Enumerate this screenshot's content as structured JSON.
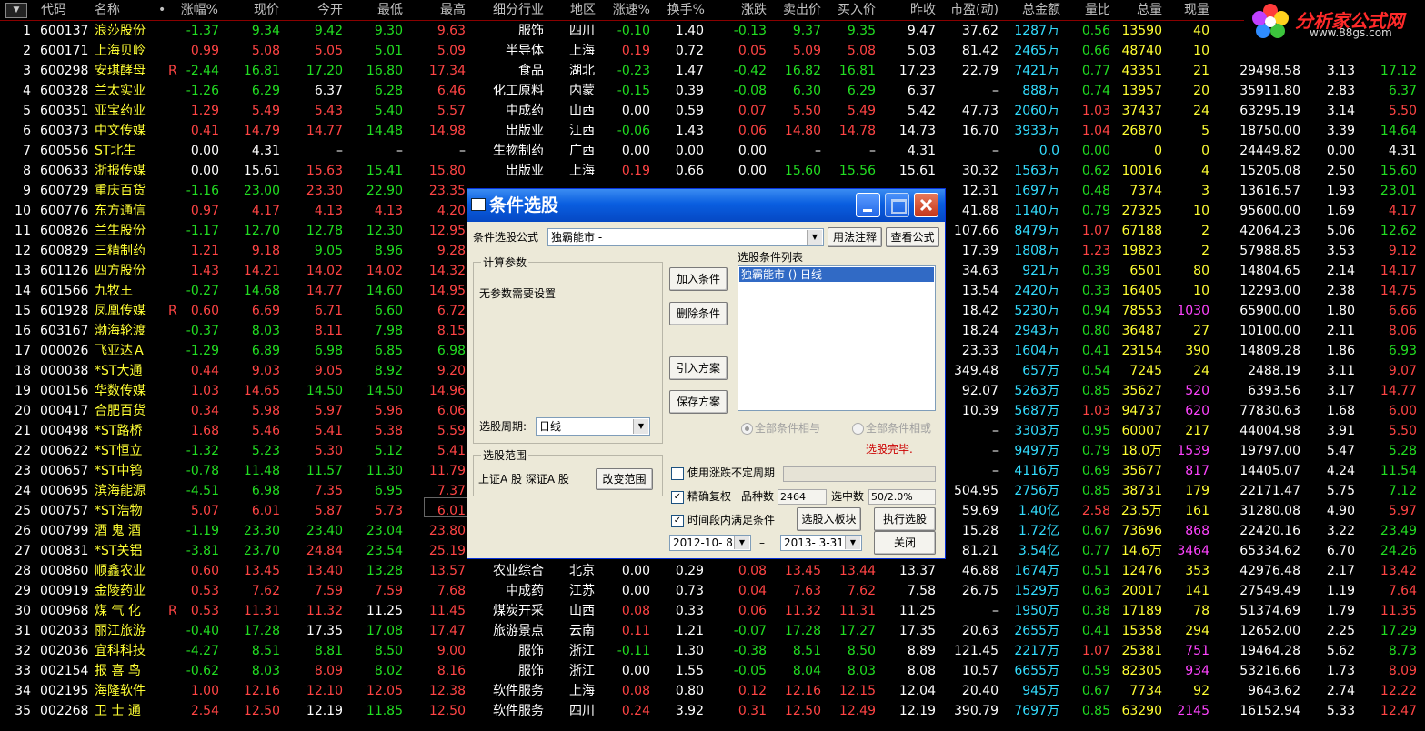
{
  "header": {
    "columns": [
      "代码",
      "名称",
      "•",
      "涨幅%",
      "现价",
      "今开",
      "最低",
      "最高",
      "细分行业",
      "地区",
      "涨速%",
      "换手%",
      "涨跌",
      "卖出价",
      "买入价",
      "昨收",
      "市盈(动)",
      "总金额",
      "量比",
      "总量",
      "现量"
    ],
    "sort_arrow_icon": "triangle-down-icon"
  },
  "logo": {
    "text": "分析家公式网",
    "url": "www.88gs.com"
  },
  "rows": [
    {
      "n": "1",
      "code": "600137",
      "name": "浪莎股份",
      "flag": "",
      "chg": "-1.37",
      "price": "9.34",
      "open": "9.42",
      "low": "9.30",
      "high": "9.63",
      "ind": "服饰",
      "region": "四川",
      "spd": "-0.10",
      "turn": "1.40",
      "diff": "-0.13",
      "ask": "9.37",
      "bid": "9.35",
      "prev": "9.47",
      "pe": "37.62",
      "amt": "1287万",
      "vr": "0.56",
      "vol": "13590",
      "cur": "40",
      "x1": "",
      "x2": "",
      "x3": ""
    },
    {
      "n": "2",
      "code": "600171",
      "name": "上海贝岭",
      "flag": "",
      "chg": "0.99",
      "price": "5.08",
      "open": "5.05",
      "low": "5.01",
      "high": "5.09",
      "ind": "半导体",
      "region": "上海",
      "spd": "0.19",
      "turn": "0.72",
      "diff": "0.05",
      "ask": "5.09",
      "bid": "5.08",
      "prev": "5.03",
      "pe": "81.42",
      "amt": "2465万",
      "vr": "0.66",
      "vol": "48740",
      "cur": "10",
      "x1": "",
      "x2": "",
      "x3": ""
    },
    {
      "n": "3",
      "code": "600298",
      "name": "安琪酵母",
      "flag": "R",
      "chg": "-2.44",
      "price": "16.81",
      "open": "17.20",
      "low": "16.80",
      "high": "17.34",
      "ind": "食品",
      "region": "湖北",
      "spd": "-0.23",
      "turn": "1.47",
      "diff": "-0.42",
      "ask": "16.82",
      "bid": "16.81",
      "prev": "17.23",
      "pe": "22.79",
      "amt": "7421万",
      "vr": "0.77",
      "vol": "43351",
      "cur": "21",
      "x1": "29498.58",
      "x2": "3.13",
      "x3": "17.12"
    },
    {
      "n": "4",
      "code": "600328",
      "name": "兰太实业",
      "flag": "",
      "chg": "-1.26",
      "price": "6.29",
      "open": "6.37",
      "low": "6.28",
      "high": "6.46",
      "ind": "化工原料",
      "region": "内蒙",
      "spd": "-0.15",
      "turn": "0.39",
      "diff": "-0.08",
      "ask": "6.30",
      "bid": "6.29",
      "prev": "6.37",
      "pe": "–",
      "amt": "888万",
      "vr": "0.74",
      "vol": "13957",
      "cur": "20",
      "x1": "35911.80",
      "x2": "2.83",
      "x3": "6.37"
    },
    {
      "n": "5",
      "code": "600351",
      "name": "亚宝药业",
      "flag": "",
      "chg": "1.29",
      "price": "5.49",
      "open": "5.43",
      "low": "5.40",
      "high": "5.57",
      "ind": "中成药",
      "region": "山西",
      "spd": "0.00",
      "turn": "0.59",
      "diff": "0.07",
      "ask": "5.50",
      "bid": "5.49",
      "prev": "5.42",
      "pe": "47.73",
      "amt": "2060万",
      "vr": "1.03",
      "vol": "37437",
      "cur": "24",
      "x1": "63295.19",
      "x2": "3.14",
      "x3": "5.50"
    },
    {
      "n": "6",
      "code": "600373",
      "name": "中文传媒",
      "flag": "",
      "chg": "0.41",
      "price": "14.79",
      "open": "14.77",
      "low": "14.48",
      "high": "14.98",
      "ind": "出版业",
      "region": "江西",
      "spd": "-0.06",
      "turn": "1.43",
      "diff": "0.06",
      "ask": "14.80",
      "bid": "14.78",
      "prev": "14.73",
      "pe": "16.70",
      "amt": "3933万",
      "vr": "1.04",
      "vol": "26870",
      "cur": "5",
      "x1": "18750.00",
      "x2": "3.39",
      "x3": "14.64"
    },
    {
      "n": "7",
      "code": "600556",
      "name": "ST北生",
      "flag": "",
      "chg": "0.00",
      "price": "4.31",
      "open": "–",
      "low": "–",
      "high": "–",
      "ind": "生物制药",
      "region": "广西",
      "spd": "0.00",
      "turn": "0.00",
      "diff": "0.00",
      "ask": "–",
      "bid": "–",
      "prev": "4.31",
      "pe": "–",
      "amt": "0.0",
      "vr": "0.00",
      "vol": "0",
      "cur": "0",
      "x1": "24449.82",
      "x2": "0.00",
      "x3": "4.31"
    },
    {
      "n": "8",
      "code": "600633",
      "name": "浙报传媒",
      "flag": "",
      "chg": "0.00",
      "price": "15.61",
      "open": "15.63",
      "low": "15.41",
      "high": "15.80",
      "ind": "出版业",
      "region": "上海",
      "spd": "0.19",
      "turn": "0.66",
      "diff": "0.00",
      "ask": "15.60",
      "bid": "15.56",
      "prev": "15.61",
      "pe": "30.32",
      "amt": "1563万",
      "vr": "0.62",
      "vol": "10016",
      "cur": "4",
      "x1": "15205.08",
      "x2": "2.50",
      "x3": "15.60"
    },
    {
      "n": "9",
      "code": "600729",
      "name": "重庆百货",
      "flag": "",
      "chg": "-1.16",
      "price": "23.00",
      "open": "23.30",
      "low": "22.90",
      "high": "23.35",
      "ind": "",
      "region": "",
      "spd": "",
      "turn": "",
      "diff": "",
      "ask": "",
      "bid": "",
      "prev": "",
      "pe": "12.31",
      "amt": "1697万",
      "vr": "0.48",
      "vol": "7374",
      "cur": "3",
      "x1": "13616.57",
      "x2": "1.93",
      "x3": "23.01"
    },
    {
      "n": "10",
      "code": "600776",
      "name": "东方通信",
      "flag": "",
      "chg": "0.97",
      "price": "4.17",
      "open": "4.13",
      "low": "4.13",
      "high": "4.20",
      "ind": "",
      "region": "",
      "spd": "",
      "turn": "",
      "diff": "",
      "ask": "",
      "bid": "",
      "prev": "",
      "pe": "41.88",
      "amt": "1140万",
      "vr": "0.79",
      "vol": "27325",
      "cur": "10",
      "x1": "95600.00",
      "x2": "1.69",
      "x3": "4.17"
    },
    {
      "n": "11",
      "code": "600826",
      "name": "兰生股份",
      "flag": "",
      "chg": "-1.17",
      "price": "12.70",
      "open": "12.78",
      "low": "12.30",
      "high": "12.95",
      "ind": "",
      "region": "",
      "spd": "",
      "turn": "",
      "diff": "",
      "ask": "",
      "bid": "",
      "prev": "",
      "pe": "107.66",
      "amt": "8479万",
      "vr": "1.07",
      "vol": "67188",
      "cur": "2",
      "x1": "42064.23",
      "x2": "5.06",
      "x3": "12.62"
    },
    {
      "n": "12",
      "code": "600829",
      "name": "三精制药",
      "flag": "",
      "chg": "1.21",
      "price": "9.18",
      "open": "9.05",
      "low": "8.96",
      "high": "9.28",
      "ind": "",
      "region": "",
      "spd": "",
      "turn": "",
      "diff": "",
      "ask": "",
      "bid": "",
      "prev": "",
      "pe": "17.39",
      "amt": "1808万",
      "vr": "1.23",
      "vol": "19823",
      "cur": "2",
      "x1": "57988.85",
      "x2": "3.53",
      "x3": "9.12"
    },
    {
      "n": "13",
      "code": "601126",
      "name": "四方股份",
      "flag": "",
      "chg": "1.43",
      "price": "14.21",
      "open": "14.02",
      "low": "14.02",
      "high": "14.32",
      "ind": "",
      "region": "",
      "spd": "",
      "turn": "",
      "diff": "",
      "ask": "",
      "bid": "",
      "prev": "",
      "pe": "34.63",
      "amt": "921万",
      "vr": "0.39",
      "vol": "6501",
      "cur": "80",
      "x1": "14804.65",
      "x2": "2.14",
      "x3": "14.17"
    },
    {
      "n": "14",
      "code": "601566",
      "name": "九牧王",
      "flag": "",
      "chg": "-0.27",
      "price": "14.68",
      "open": "14.77",
      "low": "14.60",
      "high": "14.95",
      "ind": "",
      "region": "",
      "spd": "",
      "turn": "",
      "diff": "",
      "ask": "",
      "bid": "",
      "prev": "",
      "pe": "13.54",
      "amt": "2420万",
      "vr": "0.33",
      "vol": "16405",
      "cur": "10",
      "x1": "12293.00",
      "x2": "2.38",
      "x3": "14.75"
    },
    {
      "n": "15",
      "code": "601928",
      "name": "凤凰传媒",
      "flag": "R",
      "chg": "0.60",
      "price": "6.69",
      "open": "6.71",
      "low": "6.60",
      "high": "6.72",
      "ind": "",
      "region": "",
      "spd": "",
      "turn": "",
      "diff": "",
      "ask": "",
      "bid": "",
      "prev": "",
      "pe": "18.42",
      "amt": "5230万",
      "vr": "0.94",
      "vol": "78553",
      "cur": "1030",
      "x1": "65900.00",
      "x2": "1.80",
      "x3": "6.66"
    },
    {
      "n": "16",
      "code": "603167",
      "name": "渤海轮渡",
      "flag": "",
      "chg": "-0.37",
      "price": "8.03",
      "open": "8.11",
      "low": "7.98",
      "high": "8.15",
      "ind": "",
      "region": "",
      "spd": "",
      "turn": "",
      "diff": "",
      "ask": "",
      "bid": "",
      "prev": "",
      "pe": "18.24",
      "amt": "2943万",
      "vr": "0.80",
      "vol": "36487",
      "cur": "27",
      "x1": "10100.00",
      "x2": "2.11",
      "x3": "8.06"
    },
    {
      "n": "17",
      "code": "000026",
      "name": "飞亚达Ａ",
      "flag": "",
      "chg": "-1.29",
      "price": "6.89",
      "open": "6.98",
      "low": "6.85",
      "high": "6.98",
      "ind": "",
      "region": "",
      "spd": "",
      "turn": "",
      "diff": "",
      "ask": "",
      "bid": "",
      "prev": "",
      "pe": "23.33",
      "amt": "1604万",
      "vr": "0.41",
      "vol": "23154",
      "cur": "390",
      "x1": "14809.28",
      "x2": "1.86",
      "x3": "6.93"
    },
    {
      "n": "18",
      "code": "000038",
      "name": "*ST大通",
      "flag": "",
      "chg": "0.44",
      "price": "9.03",
      "open": "9.05",
      "low": "8.92",
      "high": "9.20",
      "ind": "",
      "region": "",
      "spd": "",
      "turn": "",
      "diff": "",
      "ask": "",
      "bid": "",
      "prev": "",
      "pe": "349.48",
      "amt": "657万",
      "vr": "0.54",
      "vol": "7245",
      "cur": "24",
      "x1": "2488.19",
      "x2": "3.11",
      "x3": "9.07"
    },
    {
      "n": "19",
      "code": "000156",
      "name": "华数传媒",
      "flag": "",
      "chg": "1.03",
      "price": "14.65",
      "open": "14.50",
      "low": "14.50",
      "high": "14.96",
      "ind": "",
      "region": "",
      "spd": "",
      "turn": "",
      "diff": "",
      "ask": "",
      "bid": "",
      "prev": "",
      "pe": "92.07",
      "amt": "5263万",
      "vr": "0.85",
      "vol": "35627",
      "cur": "520",
      "x1": "6393.56",
      "x2": "3.17",
      "x3": "14.77"
    },
    {
      "n": "20",
      "code": "000417",
      "name": "合肥百货",
      "flag": "",
      "chg": "0.34",
      "price": "5.98",
      "open": "5.97",
      "low": "5.96",
      "high": "6.06",
      "ind": "",
      "region": "",
      "spd": "",
      "turn": "",
      "diff": "",
      "ask": "",
      "bid": "",
      "prev": "",
      "pe": "10.39",
      "amt": "5687万",
      "vr": "1.03",
      "vol": "94737",
      "cur": "620",
      "x1": "77830.63",
      "x2": "1.68",
      "x3": "6.00"
    },
    {
      "n": "21",
      "code": "000498",
      "name": "*ST路桥",
      "flag": "",
      "chg": "1.68",
      "price": "5.46",
      "open": "5.41",
      "low": "5.38",
      "high": "5.59",
      "ind": "",
      "region": "",
      "spd": "",
      "turn": "",
      "diff": "",
      "ask": "",
      "bid": "",
      "prev": "",
      "pe": "–",
      "amt": "3303万",
      "vr": "0.95",
      "vol": "60007",
      "cur": "217",
      "x1": "44004.98",
      "x2": "3.91",
      "x3": "5.50"
    },
    {
      "n": "22",
      "code": "000622",
      "name": "*ST恒立",
      "flag": "",
      "chg": "-1.32",
      "price": "5.23",
      "open": "5.30",
      "low": "5.12",
      "high": "5.41",
      "ind": "",
      "region": "",
      "spd": "",
      "turn": "",
      "diff": "",
      "ask": "",
      "bid": "",
      "prev": "",
      "pe": "–",
      "amt": "9497万",
      "vr": "0.79",
      "vol": "18.0万",
      "cur": "1539",
      "x1": "19797.00",
      "x2": "5.47",
      "x3": "5.28"
    },
    {
      "n": "23",
      "code": "000657",
      "name": "*ST中钨",
      "flag": "",
      "chg": "-0.78",
      "price": "11.48",
      "open": "11.57",
      "low": "11.30",
      "high": "11.79",
      "ind": "",
      "region": "",
      "spd": "",
      "turn": "",
      "diff": "",
      "ask": "",
      "bid": "",
      "prev": "",
      "pe": "–",
      "amt": "4116万",
      "vr": "0.69",
      "vol": "35677",
      "cur": "817",
      "x1": "14405.07",
      "x2": "4.24",
      "x3": "11.54"
    },
    {
      "n": "24",
      "code": "000695",
      "name": "滨海能源",
      "flag": "",
      "chg": "-4.51",
      "price": "6.98",
      "open": "7.35",
      "low": "6.95",
      "high": "7.37",
      "ind": "",
      "region": "",
      "spd": "",
      "turn": "",
      "diff": "",
      "ask": "",
      "bid": "",
      "prev": "",
      "pe": "504.95",
      "amt": "2756万",
      "vr": "0.85",
      "vol": "38731",
      "cur": "179",
      "x1": "22171.47",
      "x2": "5.75",
      "x3": "7.12"
    },
    {
      "n": "25",
      "code": "000757",
      "name": "*ST浩物",
      "flag": "",
      "chg": "5.07",
      "price": "6.01",
      "open": "5.87",
      "low": "5.73",
      "high": "6.01",
      "ind": "",
      "region": "",
      "spd": "",
      "turn": "",
      "diff": "",
      "ask": "",
      "bid": "",
      "prev": "",
      "pe": "59.69",
      "amt": "1.40亿",
      "vr": "2.58",
      "vol": "23.5万",
      "cur": "161",
      "x1": "31280.08",
      "x2": "4.90",
      "x3": "5.97"
    },
    {
      "n": "26",
      "code": "000799",
      "name": "酒 鬼 酒",
      "flag": "",
      "chg": "-1.19",
      "price": "23.30",
      "open": "23.40",
      "low": "23.04",
      "high": "23.80",
      "ind": "",
      "region": "",
      "spd": "",
      "turn": "",
      "diff": "",
      "ask": "",
      "bid": "",
      "prev": "",
      "pe": "15.28",
      "amt": "1.72亿",
      "vr": "0.67",
      "vol": "73696",
      "cur": "868",
      "x1": "22420.16",
      "x2": "3.22",
      "x3": "23.49"
    },
    {
      "n": "27",
      "code": "000831",
      "name": "*ST关铝",
      "flag": "",
      "chg": "-3.81",
      "price": "23.70",
      "open": "24.84",
      "low": "23.54",
      "high": "25.19",
      "ind": "",
      "region": "",
      "spd": "",
      "turn": "",
      "diff": "",
      "ask": "",
      "bid": "",
      "prev": "",
      "pe": "81.21",
      "amt": "3.54亿",
      "vr": "0.77",
      "vol": "14.6万",
      "cur": "3464",
      "x1": "65334.62",
      "x2": "6.70",
      "x3": "24.26"
    },
    {
      "n": "28",
      "code": "000860",
      "name": "顺鑫农业",
      "flag": "",
      "chg": "0.60",
      "price": "13.45",
      "open": "13.40",
      "low": "13.28",
      "high": "13.57",
      "ind": "农业综合",
      "region": "北京",
      "spd": "0.00",
      "turn": "0.29",
      "diff": "0.08",
      "ask": "13.45",
      "bid": "13.44",
      "prev": "13.37",
      "pe": "46.88",
      "amt": "1674万",
      "vr": "0.51",
      "vol": "12476",
      "cur": "353",
      "x1": "42976.48",
      "x2": "2.17",
      "x3": "13.42"
    },
    {
      "n": "29",
      "code": "000919",
      "name": "金陵药业",
      "flag": "",
      "chg": "0.53",
      "price": "7.62",
      "open": "7.59",
      "low": "7.59",
      "high": "7.68",
      "ind": "中成药",
      "region": "江苏",
      "spd": "0.00",
      "turn": "0.73",
      "diff": "0.04",
      "ask": "7.63",
      "bid": "7.62",
      "prev": "7.58",
      "pe": "26.75",
      "amt": "1529万",
      "vr": "0.63",
      "vol": "20017",
      "cur": "141",
      "x1": "27549.49",
      "x2": "1.19",
      "x3": "7.64"
    },
    {
      "n": "30",
      "code": "000968",
      "name": "煤 气 化",
      "flag": "R",
      "chg": "0.53",
      "price": "11.31",
      "open": "11.32",
      "low": "11.25",
      "high": "11.45",
      "ind": "煤炭开采",
      "region": "山西",
      "spd": "0.08",
      "turn": "0.33",
      "diff": "0.06",
      "ask": "11.32",
      "bid": "11.31",
      "prev": "11.25",
      "pe": "–",
      "amt": "1950万",
      "vr": "0.38",
      "vol": "17189",
      "cur": "78",
      "x1": "51374.69",
      "x2": "1.79",
      "x3": "11.35"
    },
    {
      "n": "31",
      "code": "002033",
      "name": "丽江旅游",
      "flag": "",
      "chg": "-0.40",
      "price": "17.28",
      "open": "17.35",
      "low": "17.08",
      "high": "17.47",
      "ind": "旅游景点",
      "region": "云南",
      "spd": "0.11",
      "turn": "1.21",
      "diff": "-0.07",
      "ask": "17.28",
      "bid": "17.27",
      "prev": "17.35",
      "pe": "20.63",
      "amt": "2655万",
      "vr": "0.41",
      "vol": "15358",
      "cur": "294",
      "x1": "12652.00",
      "x2": "2.25",
      "x3": "17.29"
    },
    {
      "n": "32",
      "code": "002036",
      "name": "宜科科技",
      "flag": "",
      "chg": "-4.27",
      "price": "8.51",
      "open": "8.81",
      "low": "8.50",
      "high": "9.00",
      "ind": "服饰",
      "region": "浙江",
      "spd": "-0.11",
      "turn": "1.30",
      "diff": "-0.38",
      "ask": "8.51",
      "bid": "8.50",
      "prev": "8.89",
      "pe": "121.45",
      "amt": "2217万",
      "vr": "1.07",
      "vol": "25381",
      "cur": "751",
      "x1": "19464.28",
      "x2": "5.62",
      "x3": "8.73"
    },
    {
      "n": "33",
      "code": "002154",
      "name": "报 喜 鸟",
      "flag": "",
      "chg": "-0.62",
      "price": "8.03",
      "open": "8.09",
      "low": "8.02",
      "high": "8.16",
      "ind": "服饰",
      "region": "浙江",
      "spd": "0.00",
      "turn": "1.55",
      "diff": "-0.05",
      "ask": "8.04",
      "bid": "8.03",
      "prev": "8.08",
      "pe": "10.57",
      "amt": "6655万",
      "vr": "0.59",
      "vol": "82305",
      "cur": "934",
      "x1": "53216.66",
      "x2": "1.73",
      "x3": "8.09"
    },
    {
      "n": "34",
      "code": "002195",
      "name": "海隆软件",
      "flag": "",
      "chg": "1.00",
      "price": "12.16",
      "open": "12.10",
      "low": "12.05",
      "high": "12.38",
      "ind": "软件服务",
      "region": "上海",
      "spd": "0.08",
      "turn": "0.80",
      "diff": "0.12",
      "ask": "12.16",
      "bid": "12.15",
      "prev": "12.04",
      "pe": "20.40",
      "amt": "945万",
      "vr": "0.67",
      "vol": "7734",
      "cur": "92",
      "x1": "9643.62",
      "x2": "2.74",
      "x3": "12.22"
    },
    {
      "n": "35",
      "code": "002268",
      "name": "卫 士 通",
      "flag": "",
      "chg": "2.54",
      "price": "12.50",
      "open": "12.19",
      "low": "11.85",
      "high": "12.50",
      "ind": "软件服务",
      "region": "四川",
      "spd": "0.24",
      "turn": "3.92",
      "diff": "0.31",
      "ask": "12.50",
      "bid": "12.49",
      "prev": "12.19",
      "pe": "390.79",
      "amt": "7697万",
      "vr": "0.85",
      "vol": "63290",
      "cur": "2145",
      "x1": "16152.94",
      "x2": "5.33",
      "x3": "12.47"
    }
  ],
  "dialog": {
    "title": "条件选股",
    "formula_label": "条件选股公式",
    "formula_value": "独霸能市 -",
    "usage_button": "用法注释",
    "view_formula_button": "查看公式",
    "params_group": "计算参数",
    "no_params_text": "无参数需要设置",
    "period_label": "选股周期:",
    "period_value": "日线",
    "add_button": "加入条件",
    "delete_button": "删除条件",
    "import_button": "引入方案",
    "save_button": "保存方案",
    "cond_list_label": "选股条件列表",
    "cond_item": "独霸能市  ()  日线",
    "radio_and": "全部条件相与",
    "radio_or": "全部条件相或",
    "status_text": "选股完毕.",
    "scope_group": "选股范围",
    "scope_value": "上证A 股  深证A 股",
    "change_scope_button": "改变范围",
    "chk_uncertain_period": "使用涨跌不定周期",
    "chk_exact_rights": "精确复权",
    "count_label": "品种数",
    "count_value": "2464",
    "selected_label": "选中数",
    "selected_value": "50/2.0%",
    "chk_time_range": "时间段内满足条件",
    "to_block_button": "选股入板块",
    "execute_button": "执行选股",
    "date_from": "2012-10- 8",
    "date_sep": "–",
    "date_to": "2013- 3-31",
    "close_button": "关闭"
  }
}
